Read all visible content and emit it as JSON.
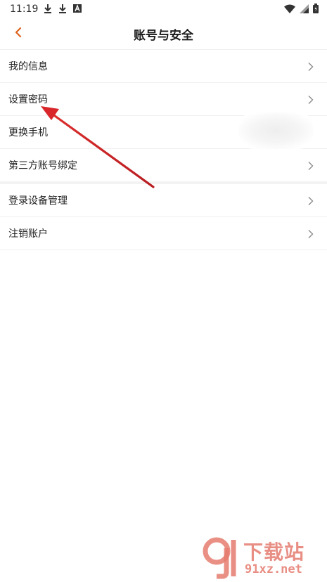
{
  "status_bar": {
    "time": "11:19",
    "icons": [
      "download-icon",
      "download-icon",
      "font-icon",
      "wifi-icon",
      "signal-icon",
      "battery-icon"
    ]
  },
  "header": {
    "title": "账号与安全",
    "back_icon": "chevron-left-icon",
    "accent_color": "#e0621c"
  },
  "list": {
    "items": [
      {
        "label": "我的信息",
        "has_chevron": true
      },
      {
        "label": "设置密码",
        "has_chevron": true
      },
      {
        "label": "更换手机",
        "has_chevron": false
      },
      {
        "label": "第三方账号绑定",
        "has_chevron": true
      },
      {
        "label": "登录设备管理",
        "has_chevron": true
      },
      {
        "label": "注销账户",
        "has_chevron": true
      }
    ]
  },
  "annotation": {
    "type": "arrow",
    "color": "#d8262b",
    "points_to": "设置密码"
  },
  "watermark": {
    "title": "下载站",
    "url": "91xz.net",
    "color": "#e57b6f"
  }
}
